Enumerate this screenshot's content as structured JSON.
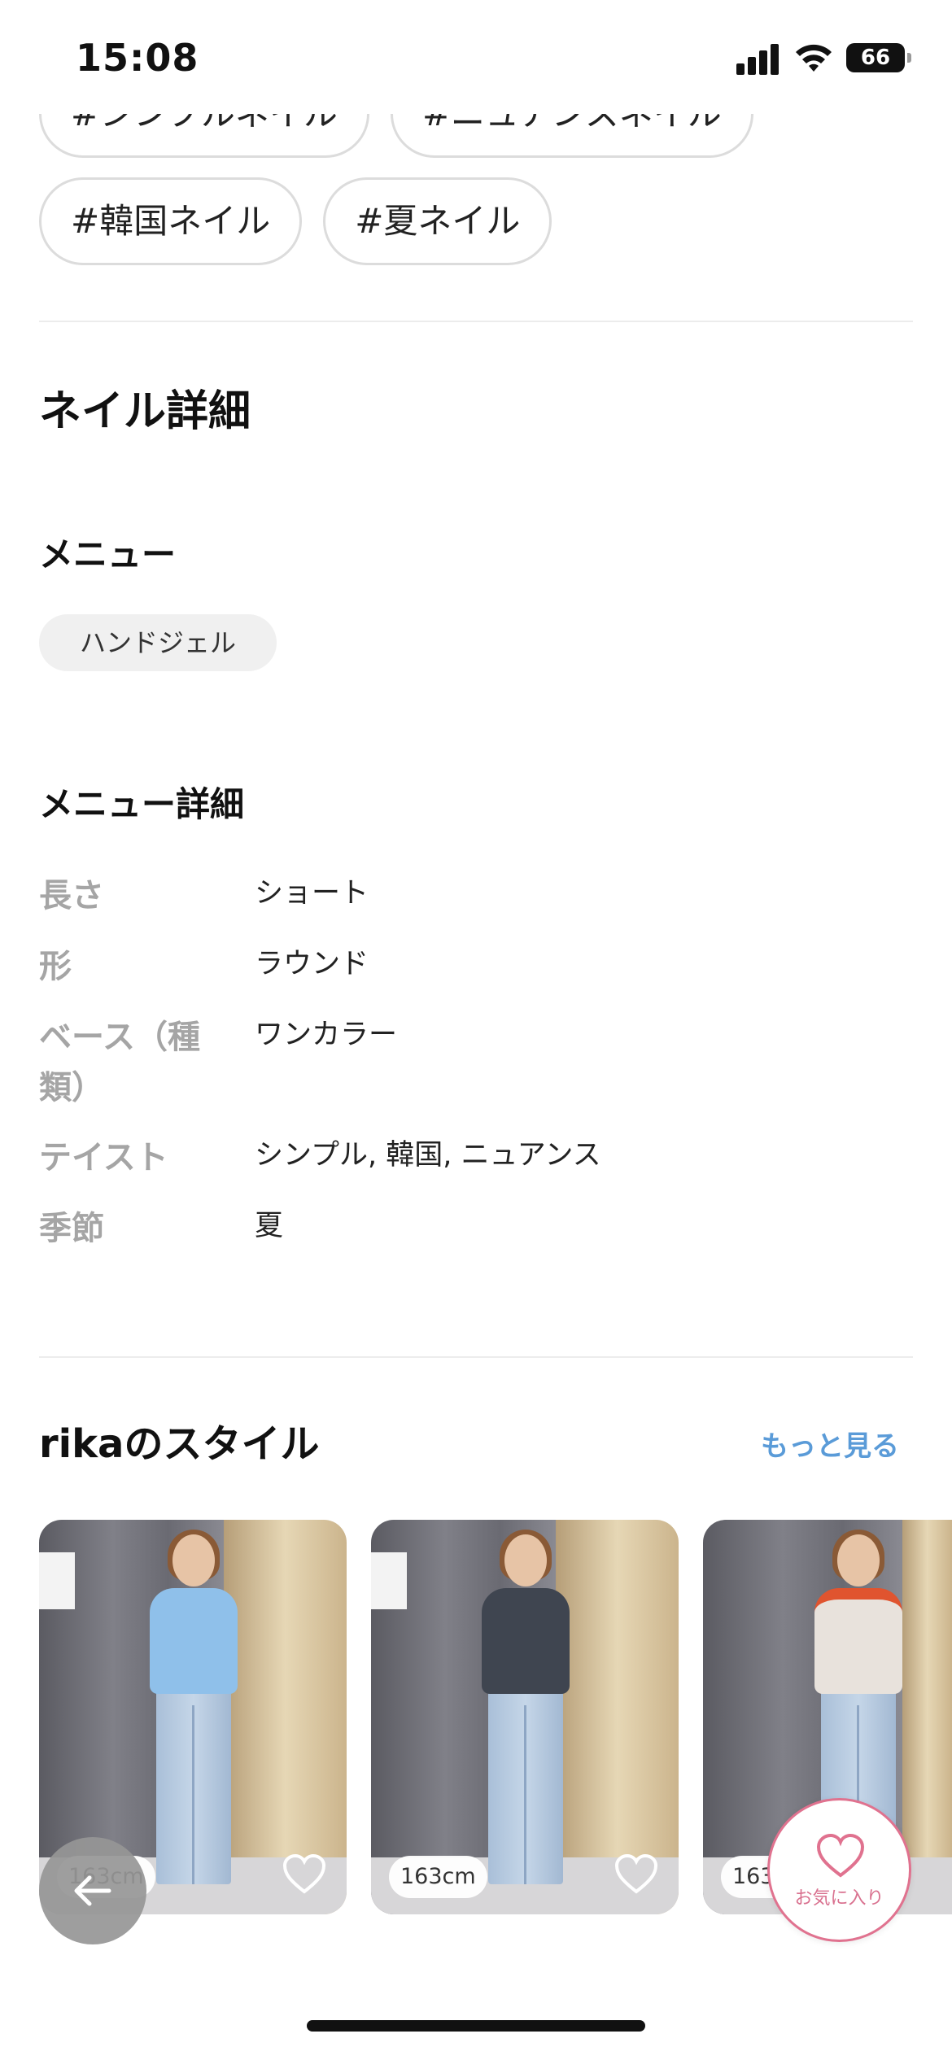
{
  "status_bar": {
    "time": "15:08",
    "battery": "66"
  },
  "tags": {
    "cut_row": [
      "#シンプルネイル",
      "#ニュアンスネイル"
    ],
    "full_row": [
      "#韓国ネイル",
      "#夏ネイル"
    ]
  },
  "nail_detail": {
    "title": "ネイル詳細",
    "menu_title": "メニュー",
    "menu_chip": "ハンドジェル",
    "menu_detail_title": "メニュー詳細",
    "rows": [
      {
        "label": "長さ",
        "value": "ショート"
      },
      {
        "label": "形",
        "value": "ラウンド"
      },
      {
        "label": "ベース（種類）",
        "value": "ワンカラー"
      },
      {
        "label": "テイスト",
        "value": "シンプル, 韓国, ニュアンス"
      },
      {
        "label": "季節",
        "value": "夏"
      }
    ]
  },
  "style_section": {
    "title": "rikaのスタイル",
    "more_link": "もっと見る",
    "cards": [
      {
        "height": "163cm",
        "top_color": "#8fc0ea"
      },
      {
        "height": "163cm",
        "top_color": "#3f4550"
      },
      {
        "height": "163cm",
        "top_color": "#e8e2dc"
      }
    ]
  },
  "favorite_button": {
    "label": "お気に入り"
  },
  "colors": {
    "accent_link": "#5a9bd8",
    "favorite_pink": "#e0728f"
  },
  "icons": [
    "signal-icon",
    "wifi-icon",
    "battery-icon",
    "heart-icon",
    "back-arrow-icon"
  ]
}
